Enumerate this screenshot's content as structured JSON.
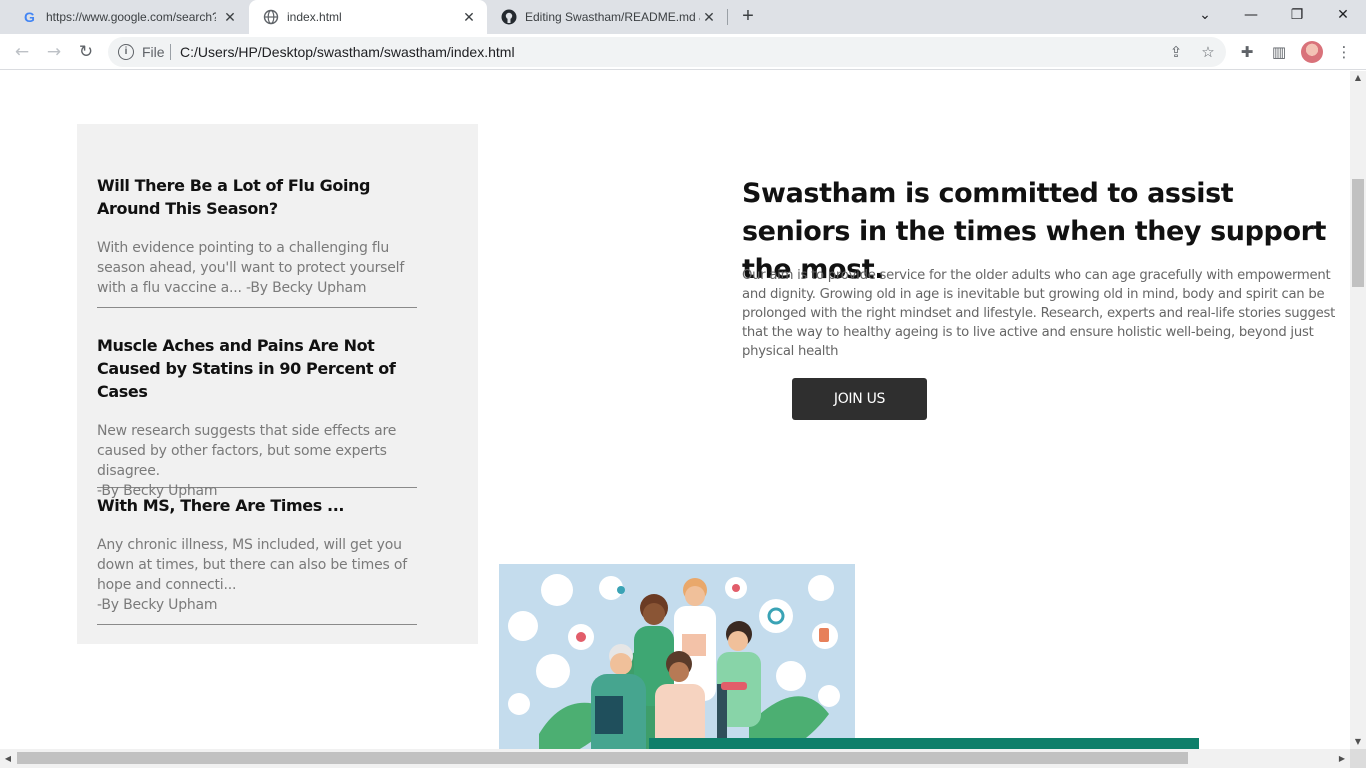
{
  "browser": {
    "tabs": [
      {
        "title": "https://www.google.com/search?",
        "active": false
      },
      {
        "title": "index.html",
        "active": true
      },
      {
        "title": "Editing Swastham/README.md a",
        "active": false
      }
    ],
    "address": {
      "scheme": "File",
      "url": "C:/Users/HP/Desktop/swastham/swastham/index.html"
    },
    "icons": {
      "back": "back-arrow-icon",
      "forward": "forward-arrow-icon",
      "reload": "reload-icon",
      "share": "share-icon",
      "bookmark": "star-icon",
      "extensions": "puzzle-icon",
      "sidepanel": "side-panel-icon",
      "menu": "kebab-menu-icon"
    }
  },
  "news": {
    "articles": [
      {
        "title": "Will There Be a Lot of Flu Going Around This Season?",
        "summary": "With evidence pointing to a challenging flu season ahead, you'll want to protect yourself with a flu vaccine a... -By Becky Upham"
      },
      {
        "title": "Muscle Aches and Pains Are Not Caused by Statins in 90 Percent of Cases",
        "summary": "New research suggests that side effects are caused by other factors, but some experts disagree.",
        "author": "-By Becky Upham"
      },
      {
        "title": "With MS, There Are Times ...",
        "summary": "Any chronic illness, MS included, will get you down at times, but there can also be times of hope and connecti...",
        "author": "-By Becky Upham"
      }
    ]
  },
  "hero": {
    "title": "Swastham is committed to assist seniors in the times when they support the most.",
    "text": "Our aim is to provide service for the older adults who can age gracefully with empowerment and dignity. Growing old in age is inevitable but growing old in mind, body and spirit can be prolonged with the right mindset and lifestyle. Research, experts and real-life stories suggest that the way to healthy ageing is to live active and ensure holistic well-being, beyond just physical health",
    "button": "JOIN US"
  },
  "colors": {
    "button_bg": "#2f2f2f",
    "panel_bg": "#f1f1f1",
    "accent_green": "#0e7f6a"
  }
}
